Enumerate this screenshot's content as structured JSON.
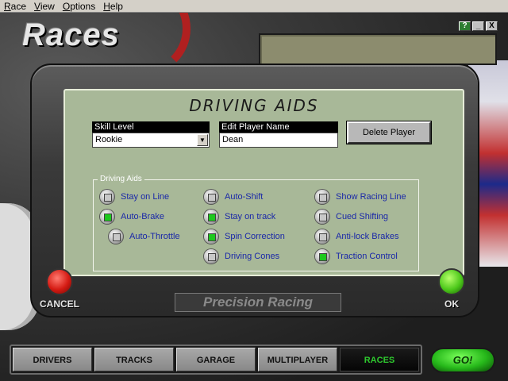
{
  "menu": [
    "Race",
    "View",
    "Options",
    "Help"
  ],
  "header": {
    "title": "Races"
  },
  "window_buttons": {
    "help": "?",
    "minimize": "_",
    "close": "X"
  },
  "dialog": {
    "title": "DRIVING AIDS",
    "skill_level": {
      "label": "Skill Level",
      "value": "Rookie"
    },
    "player_name": {
      "label": "Edit Player Name",
      "value": "Dean"
    },
    "delete_button": "Delete Player"
  },
  "driving_aids": {
    "group_label": "Driving Aids",
    "options": [
      {
        "label": "Stay on Line",
        "checked": false
      },
      {
        "label": "Auto-Brake",
        "checked": true
      },
      {
        "label": "Auto-Throttle",
        "checked": false
      },
      {
        "label": "Auto-Shift",
        "checked": false
      },
      {
        "label": "Stay on track",
        "checked": true
      },
      {
        "label": "Spin Correction",
        "checked": true
      },
      {
        "label": "Driving Cones",
        "checked": false
      },
      {
        "label": "Show Racing Line",
        "checked": false
      },
      {
        "label": "Cued Shifting",
        "checked": false
      },
      {
        "label": "Anti-lock Brakes",
        "checked": false
      },
      {
        "label": "Traction Control",
        "checked": true
      }
    ]
  },
  "actions": {
    "cancel": "CANCEL",
    "ok": "OK"
  },
  "brand": "Precision Racing",
  "tabs": [
    {
      "label": "DRIVERS",
      "active": false
    },
    {
      "label": "TRACKS",
      "active": false
    },
    {
      "label": "GARAGE",
      "active": false
    },
    {
      "label": "MULTIPLAYER",
      "active": false
    },
    {
      "label": "RACES",
      "active": true
    }
  ],
  "go_button": "GO!",
  "colors": {
    "panel": "#a8b898",
    "aid_text": "#1a28a8",
    "led_on": "#1ec81e",
    "active_tab_text": "#2ec82e"
  }
}
